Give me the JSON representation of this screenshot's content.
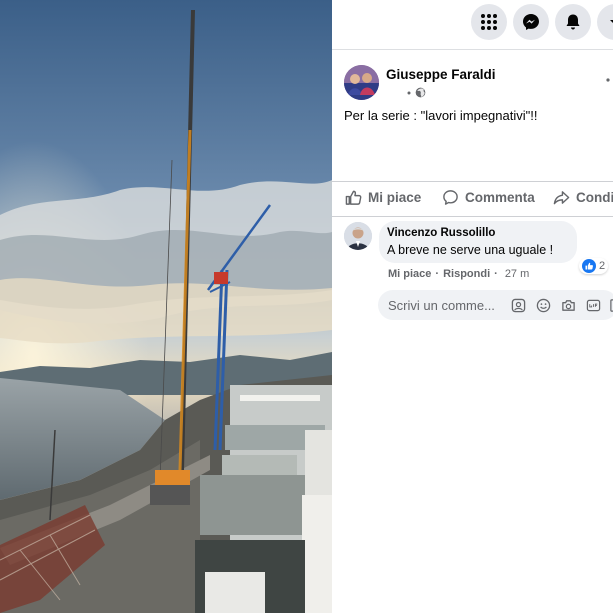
{
  "topbar": {
    "icons": [
      "menu-grid-icon",
      "messenger-icon",
      "bell-icon",
      "chevron-down-icon"
    ]
  },
  "post": {
    "author": "Giuseppe Faraldi",
    "privacy_icon": "globe-icon",
    "text": "Per la serie : \"lavori impegnativi\"!!",
    "menu_icon": "more-dots-icon"
  },
  "actions": {
    "like_label": "Mi piace",
    "comment_label": "Commenta",
    "share_label": "Condi"
  },
  "comment": {
    "author": "Vincenzo Russolillo",
    "text": "A breve ne serve una uguale !",
    "reaction_count": "2",
    "like_label": "Mi piace",
    "separator": "·",
    "reply_label": "Rispondi",
    "separator2": "·",
    "time": "27 m"
  },
  "composer": {
    "placeholder": "Scrivi un comme..."
  },
  "colors": {
    "accent": "#1877f2",
    "secondary_text": "#65676b",
    "bubble_bg": "#f0f2f5"
  }
}
